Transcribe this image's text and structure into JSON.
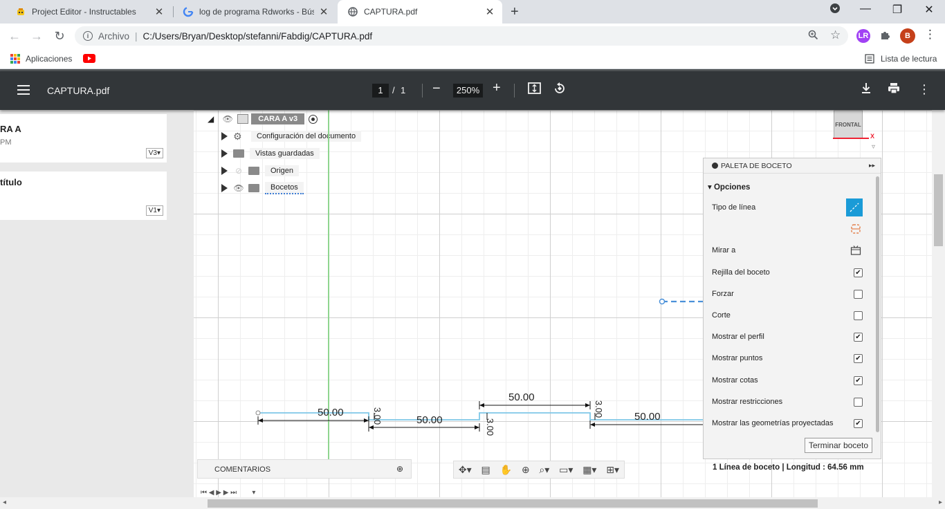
{
  "tabs": [
    {
      "title": "Project Editor - Instructables",
      "icon": "instructables-robot-icon"
    },
    {
      "title": "log de programa Rdworks - Búsq",
      "icon": "google-g-icon"
    },
    {
      "title": "CAPTURA.pdf",
      "icon": "globe-icon",
      "active": true
    }
  ],
  "omnibox": {
    "scheme": "Archivo",
    "url": "C:/Users/Bryan/Desktop/stefanni/Fabdig/CAPTURA.pdf"
  },
  "profile_initial": "B",
  "bookmarks": {
    "apps_label": "Aplicaciones",
    "reading_list": "Lista de lectura"
  },
  "pdf": {
    "filename": "CAPTURA.pdf",
    "page_current": "1",
    "page_sep": "/",
    "page_total": "1",
    "zoom": "250%"
  },
  "left_cards": [
    {
      "title": "RA A",
      "subtitle": "PM",
      "version": "V3▾"
    },
    {
      "title": "título",
      "subtitle": "",
      "version": "V1▾"
    }
  ],
  "browser_tree": {
    "root": "CARA  A v3",
    "items": [
      {
        "label": "Configuración del documento",
        "icon": "gear-icon"
      },
      {
        "label": "Vistas guardadas",
        "icon": "folder-icon"
      },
      {
        "label": "Origen",
        "icon": "folder-icon"
      },
      {
        "label": "Bocetos",
        "icon": "folder-icon"
      }
    ]
  },
  "viewcube_label": "FRONTAL",
  "axis_label": "X",
  "dimensions": {
    "d1": "50.00",
    "d2": "50.00",
    "d3": "50.00",
    "d4": "50.00",
    "h1": "3.00",
    "h2": "3.00",
    "h3": "3.00"
  },
  "palette": {
    "title": "PALETA DE BOCETO",
    "section": "Opciones",
    "line_type": "Tipo de línea",
    "look_at": "Mirar a",
    "rows": [
      {
        "label": "Rejilla del boceto",
        "checked": true
      },
      {
        "label": "Forzar",
        "checked": false
      },
      {
        "label": "Corte",
        "checked": false
      },
      {
        "label": "Mostrar el perfil",
        "checked": true
      },
      {
        "label": "Mostrar puntos",
        "checked": true
      },
      {
        "label": "Mostrar cotas",
        "checked": true
      },
      {
        "label": "Mostrar restricciones",
        "checked": false
      },
      {
        "label": "Mostrar las geometrías proyectadas",
        "checked": true
      }
    ],
    "finish_button": "Terminar boceto"
  },
  "comments_label": "COMENTARIOS",
  "status_text": "1 Línea de boceto | Longitud : 64.56 mm",
  "colors": {
    "sketch_line": "#7ec8e8",
    "accent_blue": "#1a9bd7",
    "youtube_red": "#ff0000",
    "profile_bg": "#c5401a"
  }
}
